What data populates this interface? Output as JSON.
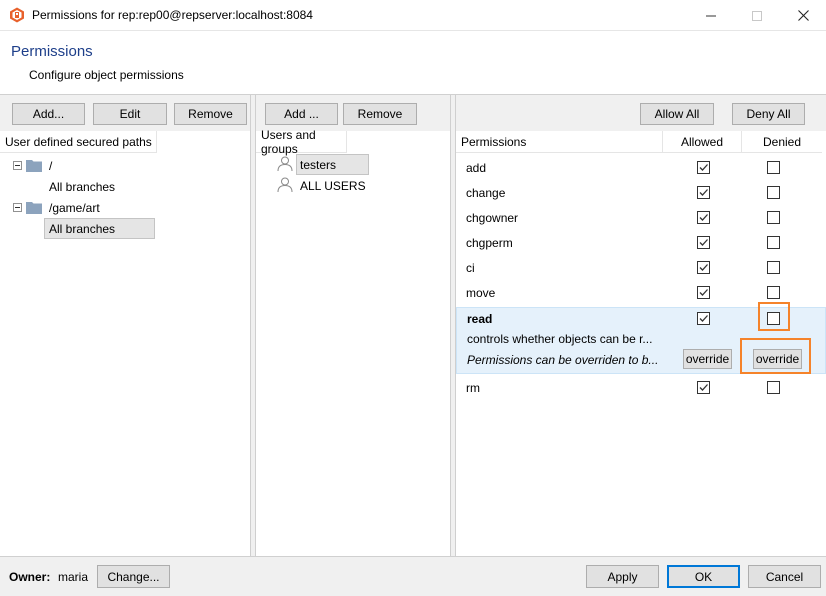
{
  "window": {
    "title": "Permissions for rep:rep00@repserver:localhost:8084",
    "brand_color": "#e8612c"
  },
  "header": {
    "title": "Permissions",
    "subtitle": "Configure object permissions"
  },
  "paths_pane": {
    "buttons": {
      "add": "Add...",
      "edit": "Edit",
      "remove": "Remove"
    },
    "column_header": "User defined secured paths",
    "tree": [
      {
        "path": "/",
        "child": "All branches",
        "child_selected": false
      },
      {
        "path": "/game/art",
        "child": "All branches",
        "child_selected": true
      }
    ]
  },
  "users_pane": {
    "buttons": {
      "add": "Add ...",
      "remove": "Remove"
    },
    "column_header": "Users and groups",
    "items": [
      {
        "name": "testers",
        "selected": true
      },
      {
        "name": "ALL USERS",
        "selected": false
      }
    ]
  },
  "permissions_pane": {
    "buttons": {
      "allow_all": "Allow All",
      "deny_all": "Deny All"
    },
    "columns": {
      "permissions": "Permissions",
      "allowed": "Allowed",
      "denied": "Denied"
    },
    "rows": [
      {
        "name": "add",
        "allowed": true,
        "denied": false
      },
      {
        "name": "change",
        "allowed": true,
        "denied": false
      },
      {
        "name": "chgowner",
        "allowed": true,
        "denied": false
      },
      {
        "name": "chgperm",
        "allowed": true,
        "denied": false
      },
      {
        "name": "ci",
        "allowed": true,
        "denied": false
      },
      {
        "name": "move",
        "allowed": true,
        "denied": false
      }
    ],
    "expanded": {
      "name": "read",
      "allowed": true,
      "denied": false,
      "description": "controls whether objects can be r...",
      "override_note": "Permissions can be overriden to b...",
      "override_allowed_label": "override",
      "override_denied_label": "override"
    },
    "after_rows": [
      {
        "name": "rm",
        "allowed": true,
        "denied": false
      }
    ],
    "highlight_color": "#f5832a"
  },
  "footer": {
    "owner_label": "Owner:",
    "owner_value": "maria",
    "change_button": "Change...",
    "apply_button": "Apply",
    "ok_button": "OK",
    "cancel_button": "Cancel"
  }
}
